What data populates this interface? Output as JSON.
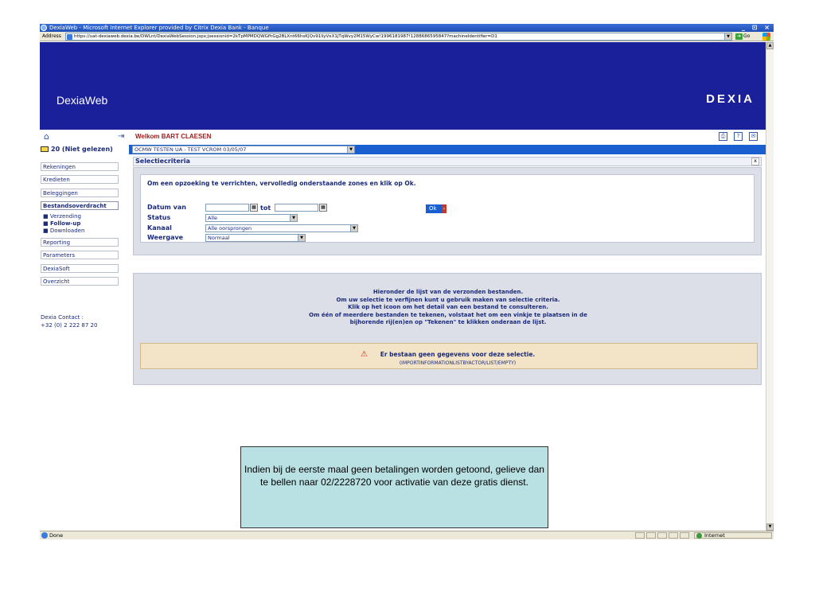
{
  "window": {
    "title": "DexiaWeb - Microsoft Internet Explorer provided by Citrix Dexia Bank - Banque",
    "controls": "_ ⊡ ×"
  },
  "address_bar": {
    "label": "Address",
    "url": "https://uat-dexiaweb.dexia.be/DWLnt/DexiaWebSession.jspx;jsessionid=2kTpMPMDQWGfhGg2BLXnt66hsK|Qv91llyVxX1jTqWvy2M15WyCw!1996181987!1288686595847?machineIdentifier=D1",
    "go_label": "Go"
  },
  "banner": {
    "brand": "DexiaWeb",
    "logo": "DEXIA",
    "color": "#1a1f9a"
  },
  "toolbar": {
    "welcome": "Welkom BART CLAESEN",
    "icons": [
      "home-icon",
      "logout-icon",
      "print-icon",
      "help-icon",
      "message-icon"
    ]
  },
  "sidebar": {
    "mail": "20 (Niet gelezen)",
    "items": [
      {
        "label": "Rekeningen"
      },
      {
        "label": "Kredieten"
      },
      {
        "label": "Beleggingen"
      },
      {
        "label": "Bestandsoverdracht"
      },
      {
        "label": "Reporting"
      },
      {
        "label": "Parameters"
      },
      {
        "label": "DexiaSoft"
      },
      {
        "label": "Overzicht"
      }
    ],
    "subitems": [
      {
        "label": "■ Verzending"
      },
      {
        "label": "■ Follow-up"
      },
      {
        "label": "■ Downloaden"
      }
    ],
    "contact": "Dexia Contact :\n+32 (0) 2 222 87 20"
  },
  "account_select": {
    "value": "OCMW TESTEN UA - TEST VCROM 03/05/07"
  },
  "criteria": {
    "title": "Selectiecriteria",
    "close": "x",
    "instruction": "Om een opzoeking te verrichten, vervolledig onderstaande zones en klik op Ok.",
    "date_label": "Datum van",
    "date_from": "",
    "tot_label": "tot",
    "date_to": "",
    "status_label": "Status",
    "status_value": "Alle",
    "kanaal_label": "Kanaal",
    "kanaal_value": "Alle oorsprongen",
    "weergave_label": "Weergave",
    "weergave_value": "Normaal",
    "ok_label": "Ok"
  },
  "results": {
    "lines": [
      "Hieronder de lijst van de verzonden bestanden.",
      "Om uw selectie te verfijnen kunt u gebruik maken van selectie criteria.",
      "Klik op het icoon om het detail van een bestand te consulteren.",
      "Om één of meerdere bestanden te tekenen, volstaat het om een vinkje te plaatsen in de",
      "bijhorende rij(en)en op \"Tekenen\" te klikken onderaan de lijst."
    ],
    "empty_message": "Er bestaan geen gegevens voor deze selectie.",
    "empty_code": "(IMPORTINFORMATIONLISTBYACTOR/LIST/EMPTY)"
  },
  "callout": {
    "text": "Indien bij de eerste maal geen betalingen worden getoond, gelieve dan te bellen naar 02/2228720 voor activatie van deze gratis dienst."
  },
  "statusbar": {
    "status": "Done",
    "zone": "Internet"
  }
}
